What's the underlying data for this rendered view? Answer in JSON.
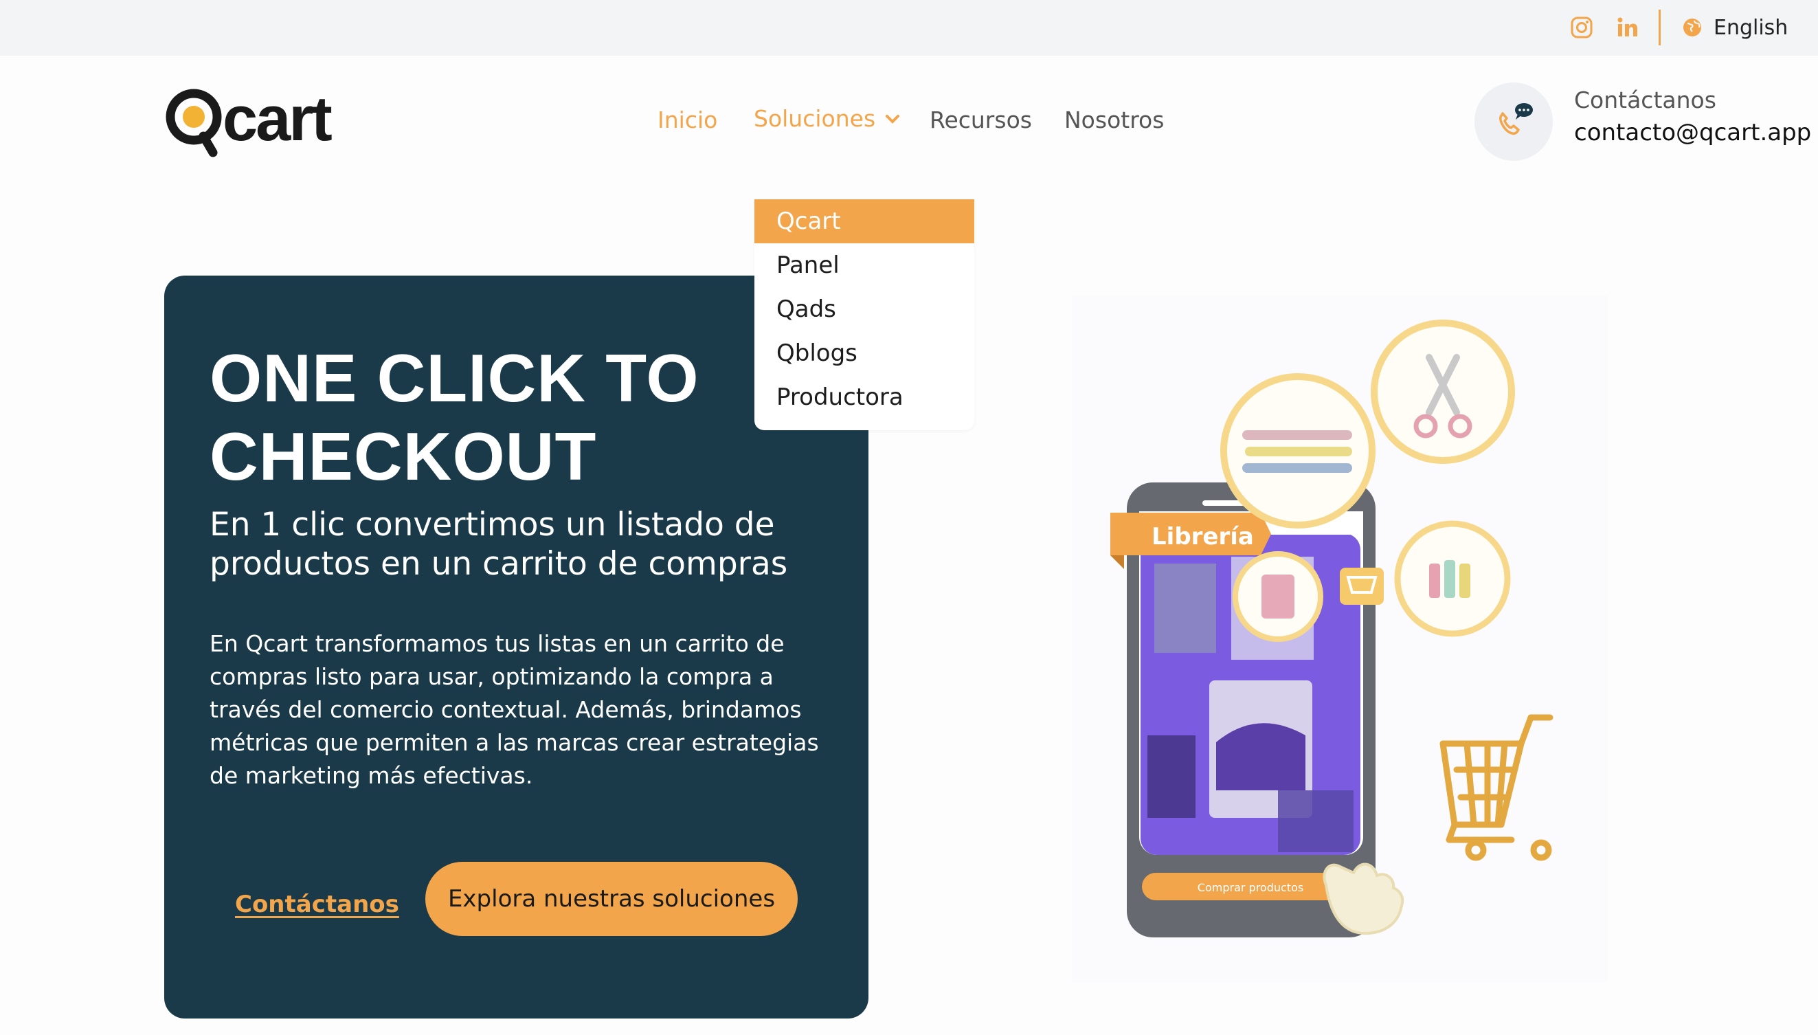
{
  "topbar": {
    "instagram_icon": "instagram-icon",
    "linkedin_icon": "linkedin-icon",
    "globe_icon": "globe-icon",
    "language": "English"
  },
  "header": {
    "logo_text": "Qcart",
    "nav": {
      "inicio": "Inicio",
      "soluciones": "Soluciones",
      "recursos": "Recursos",
      "nosotros": "Nosotros"
    },
    "contact": {
      "label": "Contáctanos",
      "email": "contacto@qcart.app",
      "icon": "phone-chat-icon"
    }
  },
  "dropdown": {
    "items": [
      "Qcart",
      "Panel",
      "Qads",
      "Qblogs",
      "Productora"
    ],
    "active": "Qcart"
  },
  "hero": {
    "title": "ONE CLICK TO CHECKOUT",
    "subtitle": "En 1 clic convertimos un listado de productos en un carrito de compras",
    "text": "En Qcart transformamos tus listas en un carrito de compras listo para usar, optimizando la compra a través del comercio contextual. Además, brindamos métricas que permiten a las marcas crear estrategias de marketing más efectivas.",
    "link_label": "Contáctanos",
    "button_label": "Explora nuestras soluciones"
  },
  "illustration": {
    "tag_label": "Librería",
    "phone_button": "Comprar productos"
  },
  "colors": {
    "accent": "#f2a54a",
    "hero_bg": "#1a3a4a",
    "topbar_bg": "#f3f4f6",
    "phone_screen": "#7b5ce0"
  }
}
